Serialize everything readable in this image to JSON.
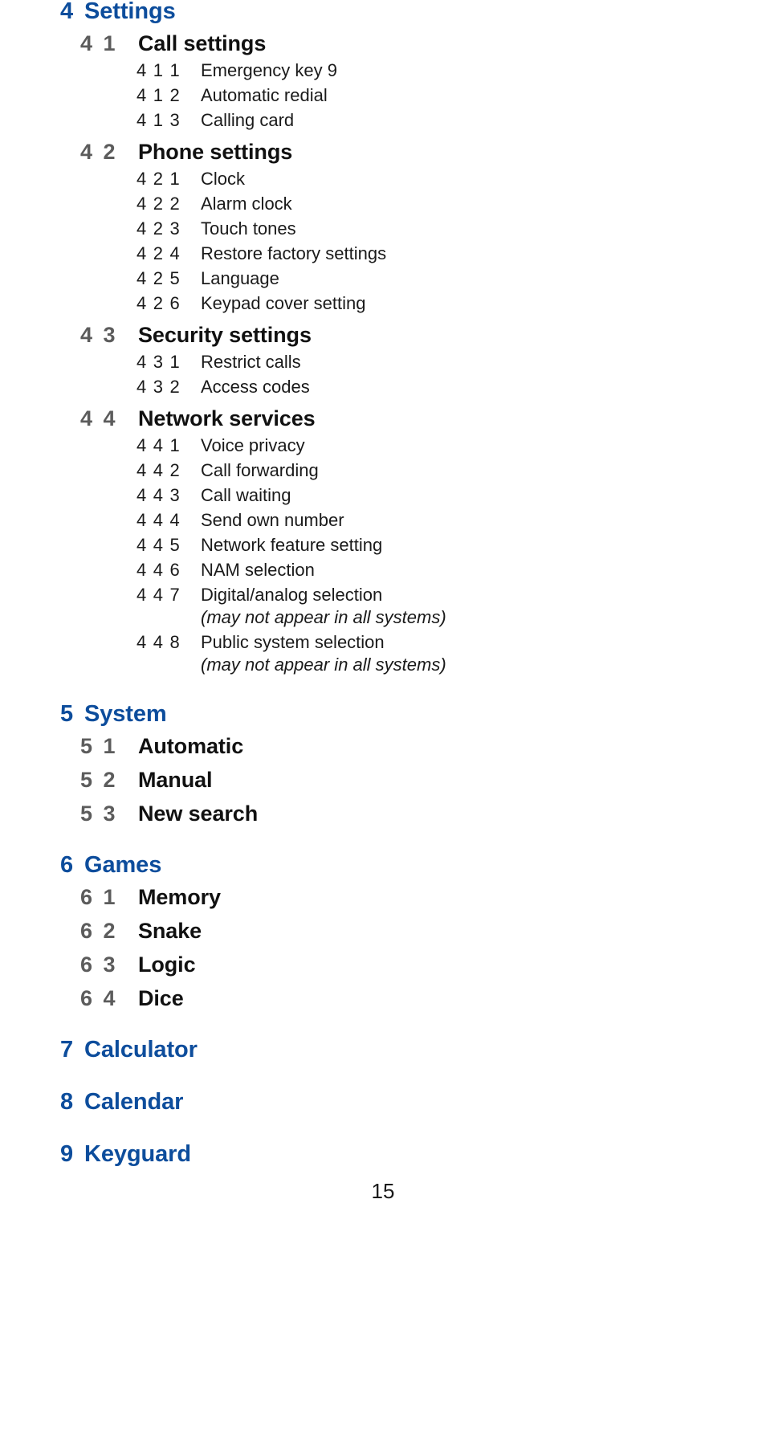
{
  "page": {
    "number": "15",
    "accent_blue": "#0d4d9c",
    "level2_number_gray": "#5c5c5c",
    "body_black": "#1a1a1a",
    "background": "#ffffff"
  },
  "toc": {
    "chapters": [
      {
        "num": "4",
        "title": "Settings",
        "sections": [
          {
            "num": "4 1",
            "title": "Call settings",
            "items": [
              {
                "num": "4 1 1",
                "title": "Emergency key 9",
                "note": ""
              },
              {
                "num": "4 1 2",
                "title": "Automatic redial",
                "note": ""
              },
              {
                "num": "4 1 3",
                "title": "Calling card",
                "note": ""
              }
            ]
          },
          {
            "num": "4 2",
            "title": "Phone settings",
            "items": [
              {
                "num": "4 2 1",
                "title": "Clock",
                "note": ""
              },
              {
                "num": "4 2 2",
                "title": "Alarm clock",
                "note": ""
              },
              {
                "num": "4 2 3",
                "title": "Touch tones",
                "note": ""
              },
              {
                "num": "4 2 4",
                "title": "Restore factory settings",
                "note": ""
              },
              {
                "num": "4 2 5",
                "title": "Language",
                "note": ""
              },
              {
                "num": "4 2 6",
                "title": "Keypad cover setting",
                "note": ""
              }
            ]
          },
          {
            "num": "4 3",
            "title": "Security settings",
            "items": [
              {
                "num": "4 3 1",
                "title": "Restrict calls",
                "note": ""
              },
              {
                "num": "4 3 2",
                "title": "Access codes",
                "note": ""
              }
            ]
          },
          {
            "num": "4 4",
            "title": "Network services",
            "items": [
              {
                "num": "4 4 1",
                "title": "Voice privacy",
                "note": ""
              },
              {
                "num": "4 4 2",
                "title": "Call forwarding",
                "note": ""
              },
              {
                "num": "4 4 3",
                "title": "Call waiting",
                "note": ""
              },
              {
                "num": "4 4 4",
                "title": "Send own number",
                "note": ""
              },
              {
                "num": "4 4 5",
                "title": "Network feature setting",
                "note": ""
              },
              {
                "num": "4 4 6",
                "title": "NAM selection",
                "note": ""
              },
              {
                "num": "4 4 7",
                "title": "Digital/analog selection",
                "note": "(may not appear in all systems)"
              },
              {
                "num": "4 4 8",
                "title": "Public system selection",
                "note": "(may not appear in all systems)"
              }
            ]
          }
        ]
      },
      {
        "num": "5",
        "title": "System",
        "sections": [
          {
            "num": "5 1",
            "title": "Automatic",
            "items": []
          },
          {
            "num": "5 2",
            "title": "Manual",
            "items": []
          },
          {
            "num": "5 3",
            "title": "New search",
            "items": []
          }
        ]
      },
      {
        "num": "6",
        "title": "Games",
        "sections": [
          {
            "num": "6 1",
            "title": "Memory",
            "items": []
          },
          {
            "num": "6 2",
            "title": "Snake",
            "items": []
          },
          {
            "num": "6 3",
            "title": "Logic",
            "items": []
          },
          {
            "num": "6 4",
            "title": "Dice",
            "items": []
          }
        ]
      },
      {
        "num": "7",
        "title": "Calculator",
        "sections": []
      },
      {
        "num": "8",
        "title": "Calendar",
        "sections": []
      },
      {
        "num": "9",
        "title": "Keyguard",
        "sections": []
      }
    ]
  }
}
